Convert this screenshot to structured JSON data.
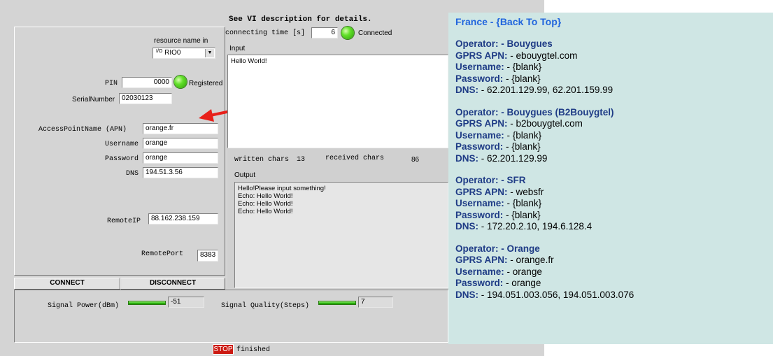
{
  "vi": {
    "description_note": "See VI description for details.",
    "connecting_time_label": "connecting time [s]",
    "connecting_time_value": "6",
    "connected_label": "Connected",
    "resource_label": "resource name in",
    "resource_value": "RIO0",
    "pin_label": "PIN",
    "pin_value": "0000",
    "registered_label": "Registered",
    "serial_label": "SerialNumber",
    "serial_value": "02030123",
    "apn_label": "AccessPointName (APN)",
    "apn_value": "orange.fr",
    "username_label": "Username",
    "username_value": "orange",
    "password_label": "Password",
    "password_value": "orange",
    "dns_label": "DNS",
    "dns_value": "194.51.3.56",
    "remote_ip_label": "RemoteIP",
    "remote_ip_value": "88.162.238.159",
    "remote_port_label": "RemotePort",
    "remote_port_value": "8383",
    "input_label": "Input",
    "input_text": "Hello World!",
    "written_label": "written chars",
    "written_value": "13",
    "received_label": "received chars",
    "received_value": "86",
    "output_label": "Output",
    "output_lines": [
      "Hello!Please input something!",
      "Echo: Hello World!",
      "Echo: Hello World!",
      "Echo: Hello World!"
    ],
    "connect_label": "CONNECT",
    "disconnect_label": "DISCONNECT",
    "signal_power_label": "Signal Power(dBm)",
    "signal_power_value": "-51",
    "signal_quality_label": "Signal Quality(Steps)",
    "signal_quality_value": "7",
    "stop_label": "STOP",
    "status_text": "finished"
  },
  "info": {
    "country": "France",
    "separator": " - ",
    "back_to_top": "{Back To Top}",
    "keys": {
      "operator": "Operator:",
      "apn": "GPRS APN:",
      "username": "Username:",
      "password": "Password:",
      "dns": "DNS:"
    },
    "operators": [
      {
        "name": "- Bouygues",
        "apn": "- ebouygtel.com",
        "username": "- {blank}",
        "password": "- {blank}",
        "dns": "- 62.201.129.99, 62.201.159.99"
      },
      {
        "name": "- Bouygues (B2Bouygtel)",
        "apn": "- b2bouygtel.com",
        "username": "- {blank}",
        "password": "- {blank}",
        "dns": "- 62.201.129.99"
      },
      {
        "name": "- SFR",
        "apn": "- websfr",
        "username": "- {blank}",
        "password": "- {blank}",
        "dns": "- 172.20.2.10, 194.6.128.4"
      },
      {
        "name": "- Orange",
        "apn": "- orange.fr",
        "username": "- orange",
        "password": "- orange",
        "dns": "- 194.051.003.056, 194.051.003.076"
      }
    ]
  },
  "colors": {
    "arrow": "#e8201a",
    "led_green": "#62e02a",
    "info_background": "#cfe6e4",
    "link_blue": "#2266dd",
    "label_navy": "#1f3c86"
  }
}
